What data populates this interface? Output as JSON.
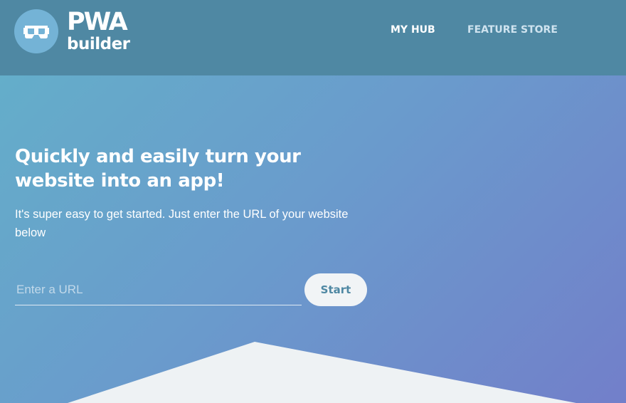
{
  "header": {
    "logo": {
      "line1": "PWA",
      "line2": "builder",
      "icon": "vr-goggles-icon"
    },
    "nav": [
      {
        "label": "MY HUB",
        "active": true
      },
      {
        "label": "FEATURE STORE",
        "active": false
      }
    ]
  },
  "hero": {
    "title": "Quickly and easily turn your website into an app!",
    "subtitle": "It's super easy to get started. Just enter the URL of your website below",
    "url_input": {
      "placeholder": "Enter a URL",
      "value": ""
    },
    "start_label": "Start"
  },
  "colors": {
    "header_bg": "#4f88a3",
    "gradient_start": "#63b1c9",
    "gradient_end": "#727fca",
    "button_bg": "#f1f4f6",
    "button_text": "#4f88a3",
    "lower_panel": "#eef2f4"
  }
}
